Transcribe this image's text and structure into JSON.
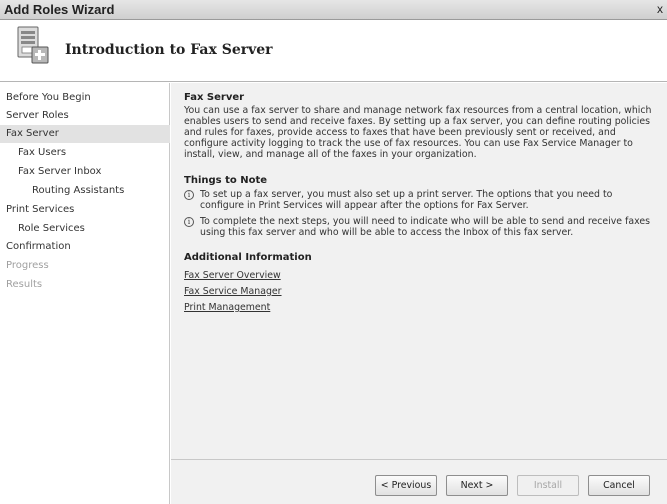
{
  "window": {
    "title": "Add Roles Wizard",
    "close_glyph": "x"
  },
  "header": {
    "heading": "Introduction to Fax Server",
    "icon": "server-icon"
  },
  "sidebar": {
    "items": [
      {
        "label": "Before You Begin",
        "indent": 0,
        "state": "normal"
      },
      {
        "label": "Server Roles",
        "indent": 0,
        "state": "normal"
      },
      {
        "label": "Fax Server",
        "indent": 0,
        "state": "selected"
      },
      {
        "label": "Fax Users",
        "indent": 1,
        "state": "normal"
      },
      {
        "label": "Fax Server Inbox",
        "indent": 1,
        "state": "normal"
      },
      {
        "label": "Routing Assistants",
        "indent": 2,
        "state": "normal"
      },
      {
        "label": "Print Services",
        "indent": 0,
        "state": "normal"
      },
      {
        "label": "Role Services",
        "indent": 1,
        "state": "normal"
      },
      {
        "label": "Confirmation",
        "indent": 0,
        "state": "normal"
      },
      {
        "label": "Progress",
        "indent": 0,
        "state": "disabled"
      },
      {
        "label": "Results",
        "indent": 0,
        "state": "disabled"
      }
    ]
  },
  "main": {
    "section_title": "Fax Server",
    "description": "You can use a fax server to share and manage network fax resources from a central location, which enables users to send and receive faxes. By setting up a fax server, you can define routing policies and rules for faxes, provide access to faxes that have been previously sent or received, and configure activity logging to track the use of fax resources. You can use Fax Service Manager to install, view, and manage all of the faxes in your organization.",
    "notes_title": "Things to Note",
    "notes": [
      "To set up a fax server, you must also set up a print server. The options that you need to configure in Print Services will appear after the options for Fax Server.",
      "To complete the next steps, you will need to indicate who will be able to send and receive faxes using this fax server and who will be able to access the Inbox of this fax server."
    ],
    "info_glyph": "i",
    "additional_title": "Additional Information",
    "links": [
      "Fax Server Overview",
      "Fax Service Manager",
      "Print Management"
    ]
  },
  "footer": {
    "previous_label": "< Previous",
    "next_label": "Next >",
    "install_label": "Install",
    "cancel_label": "Cancel",
    "install_enabled": false
  },
  "colors": {
    "sidebar_selected": "#e2e2e2",
    "content_background": "#f1f1f1",
    "disabled_text": "#a0a0a0"
  }
}
